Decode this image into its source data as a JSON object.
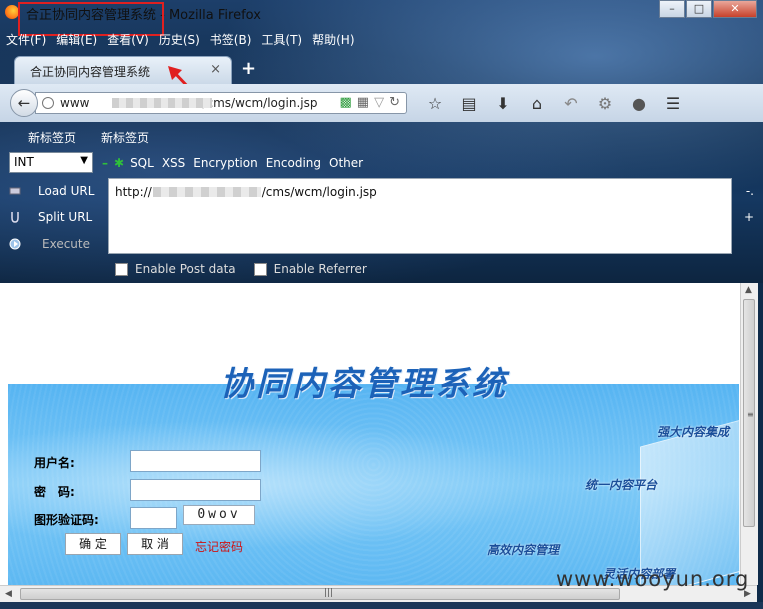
{
  "window": {
    "title": "合正协同内容管理系统 - Mozilla Firefox"
  },
  "menubar": [
    "文件(F)",
    "编辑(E)",
    "查看(V)",
    "历史(S)",
    "书签(B)",
    "工具(T)",
    "帮助(H)"
  ],
  "tab": {
    "title": "合正协同内容管理系统",
    "close": "×",
    "new_tab": "+"
  },
  "navbar": {
    "url_prefix": "www",
    "url_suffix": "/cms/wcm/login.jsp"
  },
  "bookmarks": [
    "新标签页",
    "新标签页"
  ],
  "hackbar": {
    "select_value": "INT",
    "menus": [
      "SQL",
      "XSS",
      "Encryption",
      "Encoding",
      "Other"
    ],
    "load_url": "Load URL",
    "split_url": "Split URL",
    "execute": "Execute",
    "textarea_prefix": "http://",
    "textarea_suffix": "/cms/wcm/login.jsp",
    "enable_post": "Enable Post data",
    "enable_referrer": "Enable Referrer"
  },
  "page": {
    "system_title": "协同内容管理系统",
    "username_label": "用户名:",
    "password_label": "密　码:",
    "captcha_label": "图形验证码:",
    "captcha_value": "0wov",
    "confirm_button": "确 定",
    "cancel_button": "取 消",
    "forgot_link": "忘记密码",
    "slogans": [
      "强大内容集成",
      "统一内容平台",
      "高效内容管理",
      "灵活内容部署"
    ]
  },
  "watermark": "www.wooyun.org",
  "colors": {
    "accent_red": "#e02020",
    "title_blue": "#1c62b8",
    "banner_blue": "#5db8f2"
  }
}
